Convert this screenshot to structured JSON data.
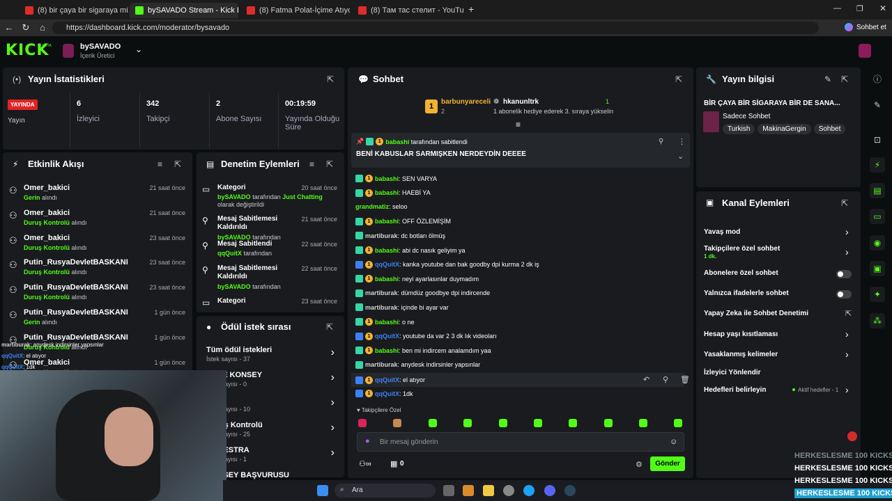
{
  "browser": {
    "tabs": [
      {
        "label": "(8) bir çaya bir sigaraya müptelayı",
        "fav": "#e02b2b"
      },
      {
        "label": "bySAVADO Stream - Kick Dashboard",
        "fav": "#53fc18"
      },
      {
        "label": "(8) Fatma Polat-İçime Atıyorum aşı",
        "fav": "#e02b2b"
      },
      {
        "label": "(8) Там тас стелит - YouTube",
        "fav": "#e02b2b"
      }
    ],
    "url": "https://dashboard.kick.com/moderator/bysavado",
    "profile_button": "Sohbet et"
  },
  "header": {
    "logo": "KICK",
    "logo_beta": "BETA",
    "channel": "bySAVADO",
    "role": "İçerik Üretici"
  },
  "stats": {
    "title": "Yayın İstatistikleri",
    "live_badge": "YAYINDA",
    "live_label": "Yayın",
    "items": [
      {
        "value": "6",
        "label": "İzleyici"
      },
      {
        "value": "342",
        "label": "Takipçi"
      },
      {
        "value": "2",
        "label": "Abone Sayısı"
      },
      {
        "value": "00:19:59",
        "label": "Yayında Olduğu Süre"
      }
    ]
  },
  "activity": {
    "title": "Etkinlik Akışı",
    "rows": [
      {
        "name": "Omer_bakici",
        "action": "Gerin",
        "suffix": "alındı",
        "time": "21 saat önce"
      },
      {
        "name": "Omer_bakici",
        "action": "Duruş Kontrolü",
        "suffix": "alındı",
        "time": "21 saat önce"
      },
      {
        "name": "Omer_bakici",
        "action": "Duruş Kontrolü",
        "suffix": "alındı",
        "time": "23 saat önce"
      },
      {
        "name": "Putin_RusyaDevletBASKANI",
        "action": "Duruş Kontrolü",
        "suffix": "alındı",
        "time": "23 saat önce"
      },
      {
        "name": "Putin_RusyaDevletBASKANI",
        "action": "Duruş Kontrolü",
        "suffix": "alındı",
        "time": "23 saat önce"
      },
      {
        "name": "Putin_RusyaDevletBASKANI",
        "action": "Gerin",
        "suffix": "alındı",
        "time": "1 gün önce"
      },
      {
        "name": "Putin_RusyaDevletBASKANI",
        "action": "Duruş Kontrolü",
        "suffix": "alındı",
        "time": "1 gün önce"
      },
      {
        "name": "Omer_bakici",
        "action": "Duruş Kontrolü",
        "suffix": "alındı",
        "time": "1 gün önce"
      }
    ]
  },
  "moderation": {
    "title": "Denetim Eylemleri",
    "rows": [
      {
        "title": "Kategori",
        "time": "20 saat önce",
        "user": "bySAVADO",
        "text": "tarafından",
        "extra": "Just Chatting",
        "tail": "olarak değiştirildi"
      },
      {
        "title": "Mesaj Sabitlemesi Kaldırıldı",
        "time": "21 saat önce",
        "user": "bySAVADO",
        "text": "tarafından"
      },
      {
        "title": "Mesaj Sabitlendi",
        "time": "22 saat önce",
        "user": "qqQuitX",
        "text": "tarafından"
      },
      {
        "title": "Mesaj Sabitlemesi Kaldırıldı",
        "time": "22 saat önce",
        "user": "bySAVADO",
        "text": "tarafından"
      },
      {
        "title": "Kategori",
        "time": "23 saat önce"
      }
    ]
  },
  "rewards": {
    "title": "Ödül istek sırası",
    "items": [
      {
        "title": "Tüm ödül istekleri",
        "sub": "İstek sayısı - 37"
      },
      {
        "title": "YÜCE KONSEY",
        "sub": "İstek sayısı - 0"
      },
      {
        "title": "Gerin",
        "sub": "İstek sayısı - 10"
      },
      {
        "title": "Duruş Kontrolü",
        "sub": "İstek sayısı - 25"
      },
      {
        "title": "ORKESTRA",
        "sub": "İstek sayısı - 1"
      },
      {
        "title": "KONSEY BAŞVURUSU",
        "sub": ""
      }
    ]
  },
  "chat": {
    "title": "Sohbet",
    "top1_name": "barbunyareceli",
    "top1_count": "2",
    "top2_name": "hkanunltrk",
    "top2_count": "1",
    "top2_sub": "1 abonelik hediye ederek 3. sıraya yükselin",
    "pinned_by": "babashi",
    "pinned_by_suffix": "tarafından sabitlendi",
    "pinned_text": "BENİ KABUSLAR SARMIŞKEN NERDEYDİN DEEEE",
    "messages": [
      {
        "user": "babashi",
        "text": ": SEN VARYA",
        "color": "g",
        "badges": 2
      },
      {
        "user": "babashi",
        "text": ": HAEBİ YA",
        "color": "g",
        "badges": 2
      },
      {
        "user": "grandmatiz",
        "text": ": seloo",
        "color": "g",
        "badges": 0
      },
      {
        "user": "babashi",
        "text": ": OFF ÖZLEMİŞİM",
        "color": "g",
        "badges": 2
      },
      {
        "user": "martiburak",
        "text": ": dc botları ölmüş",
        "color": "gray",
        "badges": 1
      },
      {
        "user": "babashi",
        "text": ": abi dc nasık geliyim ya",
        "color": "g",
        "badges": 2
      },
      {
        "user": "qqQuitX",
        "text": ": kanka youtube dan bak goodby dpi kurma 2 dk iş",
        "color": "b",
        "badges": 2
      },
      {
        "user": "babashi",
        "text": ": neyi ayarlasınlar duymadım",
        "color": "g",
        "badges": 2
      },
      {
        "user": "martiburak",
        "text": ": dümdüz goodbye dpi indircende",
        "color": "gray",
        "badges": 1
      },
      {
        "user": "martiburak",
        "text": ": içinde bi ayar var",
        "color": "gray",
        "badges": 1
      },
      {
        "user": "babashi",
        "text": ": o ne",
        "color": "g",
        "badges": 2
      },
      {
        "user": "qqQuitX",
        "text": ": youtube da var 2 3 dk lık videoları",
        "color": "b",
        "badges": 2
      },
      {
        "user": "babashi",
        "text": ": ben mi indircem analamdım yaa",
        "color": "g",
        "badges": 2
      },
      {
        "user": "martiburak",
        "text": ": anydesk indirsinler yapsınlar",
        "color": "gray",
        "badges": 1
      },
      {
        "user": "qqQuitX",
        "text": ": el atıyor",
        "color": "b",
        "badges": 2
      },
      {
        "user": "qqQuitX",
        "text": ": 1dk",
        "color": "b",
        "badges": 2
      }
    ],
    "followers_only": "Takipçilere Özel",
    "input_placeholder": "Bir mesaj gönderin",
    "points": "0",
    "send": "Gönder"
  },
  "stream_info": {
    "title": "Yayın bilgisi",
    "stream_title": "BİR ÇAYA BİR SİGARAYA BİR DE SANA...",
    "category": "Sadece Sohbet",
    "tags": [
      "Turkish",
      "MakinaGergin",
      "Sohbet"
    ]
  },
  "channel_actions": {
    "title": "Kanal Eylemleri",
    "items": [
      {
        "label": "Yavaş mod",
        "control": "chevron"
      },
      {
        "label": "Takipçilere özel sohbet",
        "sub": "1 dk.",
        "control": "chevron"
      },
      {
        "label": "Abonelere özel sohbet",
        "control": "toggle"
      },
      {
        "label": "Yalnızca ifadelerle sohbet",
        "control": "toggle"
      },
      {
        "label": "Yapay Zeka ile Sohbet Denetimi",
        "control": "external"
      },
      {
        "label": "Hesap yaşı kısıtlaması",
        "control": "chevron"
      },
      {
        "label": "Yasaklanmış kelimeler",
        "control": "chevron"
      },
      {
        "label": "İzleyici Yönlendir",
        "control": "none"
      },
      {
        "label": "Hedefleri belirleyin",
        "extra": "Aktif hedefler - 1",
        "control": "chevron"
      }
    ]
  },
  "overlay": {
    "chat1_user": "martiburak",
    "chat1_text": ": anydesk indirsinler yapsınlar",
    "chat2_user": "qqQuitX",
    "chat2_text": ": el atıyor",
    "chat3_user": "qqQuitX",
    "chat3_text": ": 1dk",
    "hk_lines": [
      "HERKESLESME 100 KICKS",
      "HERKESLESME 100 KICKS",
      "HERKESLESME 100 KICKS",
      "HERKESLESME 100 KICKS"
    ]
  },
  "taskbar": {
    "search": "Ara"
  }
}
